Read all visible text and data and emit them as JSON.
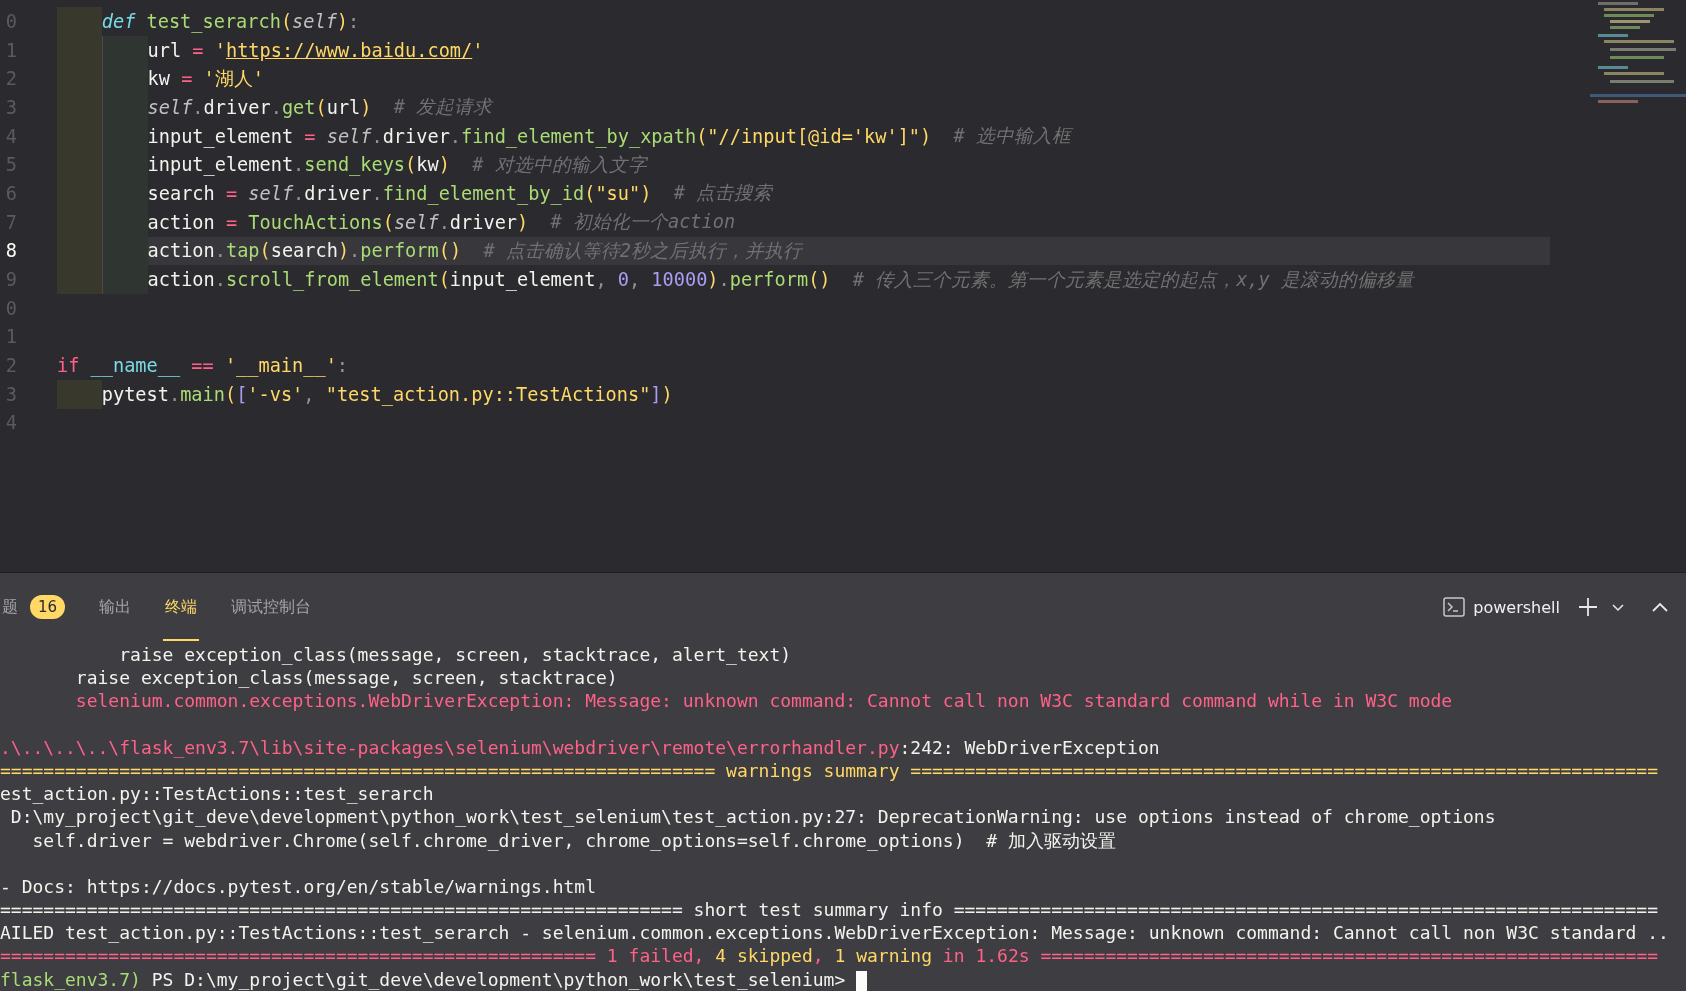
{
  "editor": {
    "lines": [
      {
        "number": "0",
        "current": false,
        "kind": "indent1",
        "tokens": [
          {
            "kind": "kw",
            "text": "def"
          },
          {
            "kind": "fn",
            "text": "test_serarch"
          },
          {
            "kind": "bracket",
            "text": "("
          },
          {
            "kind": "self",
            "text": "self"
          },
          {
            "kind": "bracket",
            "text": ")"
          },
          {
            "kind": "punct",
            "text": ":"
          }
        ]
      },
      {
        "number": "1",
        "current": false,
        "kind": "indent2",
        "tokens": [
          {
            "kind": "plain",
            "text": "url"
          },
          {
            "kind": "op",
            "text": " = "
          },
          {
            "kind": "str",
            "text": "'"
          },
          {
            "kind": "url",
            "text": "https://www.baidu.com/"
          },
          {
            "kind": "str",
            "text": "'"
          }
        ]
      },
      {
        "number": "2",
        "current": false,
        "kind": "indent2",
        "tokens": [
          {
            "kind": "plain",
            "text": "kw"
          },
          {
            "kind": "op",
            "text": " = "
          },
          {
            "kind": "str",
            "text": "'湖人'"
          }
        ]
      },
      {
        "number": "3",
        "current": false,
        "kind": "indent2",
        "tokens": [
          {
            "kind": "self",
            "text": "self"
          },
          {
            "kind": "punct",
            "text": "."
          },
          {
            "kind": "plain",
            "text": "driver"
          },
          {
            "kind": "punct",
            "text": "."
          },
          {
            "kind": "method",
            "text": "get"
          },
          {
            "kind": "bracket",
            "text": "("
          },
          {
            "kind": "plain",
            "text": "url"
          },
          {
            "kind": "bracket",
            "text": ")"
          },
          {
            "kind": "cmt",
            "text": "# 发起请求"
          }
        ]
      },
      {
        "number": "4",
        "current": false,
        "kind": "indent2",
        "tokens": [
          {
            "kind": "plain",
            "text": "input_element"
          },
          {
            "kind": "op",
            "text": " = "
          },
          {
            "kind": "self",
            "text": "self"
          },
          {
            "kind": "punct",
            "text": "."
          },
          {
            "kind": "plain",
            "text": "driver"
          },
          {
            "kind": "punct",
            "text": "."
          },
          {
            "kind": "method",
            "text": "find_element_by_xpath"
          },
          {
            "kind": "bracket",
            "text": "("
          },
          {
            "kind": "str",
            "text": "\"//input[@id='kw']\""
          },
          {
            "kind": "bracket",
            "text": ")"
          },
          {
            "kind": "cmt",
            "text": "# 选中输入框"
          }
        ]
      },
      {
        "number": "5",
        "current": false,
        "kind": "indent2",
        "tokens": [
          {
            "kind": "plain",
            "text": "input_element"
          },
          {
            "kind": "punct",
            "text": "."
          },
          {
            "kind": "method",
            "text": "send_keys"
          },
          {
            "kind": "bracket",
            "text": "("
          },
          {
            "kind": "plain",
            "text": "kw"
          },
          {
            "kind": "bracket",
            "text": ")"
          },
          {
            "kind": "cmt",
            "text": "# 对选中的输入文字"
          }
        ]
      },
      {
        "number": "6",
        "current": false,
        "kind": "indent2",
        "tokens": [
          {
            "kind": "plain",
            "text": "search"
          },
          {
            "kind": "op",
            "text": " = "
          },
          {
            "kind": "self",
            "text": "self"
          },
          {
            "kind": "punct",
            "text": "."
          },
          {
            "kind": "plain",
            "text": "driver"
          },
          {
            "kind": "punct",
            "text": "."
          },
          {
            "kind": "method",
            "text": "find_element_by_id"
          },
          {
            "kind": "bracket",
            "text": "("
          },
          {
            "kind": "str",
            "text": "\"su\""
          },
          {
            "kind": "bracket",
            "text": ")"
          },
          {
            "kind": "cmt",
            "text": "# 点击搜索"
          }
        ]
      },
      {
        "number": "7",
        "current": false,
        "kind": "indent2",
        "tokens": [
          {
            "kind": "plain",
            "text": "action"
          },
          {
            "kind": "op",
            "text": " = "
          },
          {
            "kind": "method",
            "text": "TouchActions"
          },
          {
            "kind": "bracket",
            "text": "("
          },
          {
            "kind": "self",
            "text": "self"
          },
          {
            "kind": "punct",
            "text": "."
          },
          {
            "kind": "plain",
            "text": "driver"
          },
          {
            "kind": "bracket",
            "text": ")"
          },
          {
            "kind": "cmt",
            "text": "# 初始化一个action"
          }
        ]
      },
      {
        "number": "8",
        "current": true,
        "kind": "indent2",
        "tokens": [
          {
            "kind": "plain",
            "text": "action"
          },
          {
            "kind": "punct",
            "text": "."
          },
          {
            "kind": "method",
            "text": "tap"
          },
          {
            "kind": "bracket",
            "text": "("
          },
          {
            "kind": "plain",
            "text": "search"
          },
          {
            "kind": "bracket",
            "text": ")"
          },
          {
            "kind": "punct",
            "text": "."
          },
          {
            "kind": "method",
            "text": "perform"
          },
          {
            "kind": "bracket",
            "text": "()"
          },
          {
            "kind": "cmt",
            "text": "# 点击确认等待2秒之后执行，并执行"
          }
        ]
      },
      {
        "number": "9",
        "current": false,
        "kind": "indent2",
        "tokens": [
          {
            "kind": "plain",
            "text": "action"
          },
          {
            "kind": "punct",
            "text": "."
          },
          {
            "kind": "method",
            "text": "scroll_from_element"
          },
          {
            "kind": "bracket",
            "text": "("
          },
          {
            "kind": "plain",
            "text": "input_element"
          },
          {
            "kind": "punct",
            "text": ", "
          },
          {
            "kind": "num",
            "text": "0"
          },
          {
            "kind": "punct",
            "text": ", "
          },
          {
            "kind": "num",
            "text": "10000"
          },
          {
            "kind": "bracket",
            "text": ")"
          },
          {
            "kind": "punct",
            "text": "."
          },
          {
            "kind": "method",
            "text": "perform"
          },
          {
            "kind": "bracket",
            "text": "()"
          },
          {
            "kind": "cmt",
            "text": "# 传入三个元素。第一个元素是选定的起点，x,y 是滚动的偏移量"
          }
        ]
      },
      {
        "number": "0",
        "current": false,
        "kind": "top"
      },
      {
        "number": "1",
        "current": false,
        "kind": "top"
      },
      {
        "number": "2",
        "current": false,
        "kind": "top",
        "tokens": [
          {
            "kind": "kw2",
            "text": "if"
          },
          {
            "kind": "dunder",
            "text": "__name__"
          },
          {
            "kind": "op",
            "text": " == "
          },
          {
            "kind": "str",
            "text": "'__main__'"
          },
          {
            "kind": "punct",
            "text": ":"
          }
        ]
      },
      {
        "number": "3",
        "current": false,
        "kind": "indent1",
        "tokens": [
          {
            "kind": "plain",
            "text": "pytest"
          },
          {
            "kind": "punct",
            "text": "."
          },
          {
            "kind": "method",
            "text": "main"
          },
          {
            "kind": "bracket",
            "text": "("
          },
          {
            "kind": "bracket2",
            "text": "["
          },
          {
            "kind": "str",
            "text": "'-vs'"
          },
          {
            "kind": "punct",
            "text": ", "
          },
          {
            "kind": "str",
            "text": "\"test_action.py::TestActions\""
          },
          {
            "kind": "bracket2",
            "text": "]"
          },
          {
            "kind": "bracket",
            "text": ")"
          }
        ]
      },
      {
        "number": "4",
        "current": false,
        "kind": "top"
      }
    ]
  },
  "panel": {
    "tabs": [
      {
        "label": "题",
        "selected": false,
        "badge": "16"
      },
      {
        "label": "输出",
        "selected": false
      },
      {
        "label": "终端",
        "selected": true
      },
      {
        "label": "调试控制台",
        "selected": false
      }
    ],
    "shell": "powershell"
  },
  "terminal": {
    "lines": [
      {
        "segments": [
          {
            "kind": "text",
            "text": "           raise exception_class(message, screen, stacktrace, alert_text)"
          }
        ]
      },
      {
        "segments": [
          {
            "kind": "text",
            "text": "       raise exception_class(message, screen, stacktrace)"
          }
        ]
      },
      {
        "segments": [
          {
            "kind": "error",
            "text": "       selenium.common.exceptions.WebDriverException: Message: unknown command: Cannot call non W3C standard command while in W3C mode"
          }
        ]
      },
      {
        "gap_above": true,
        "segments": [
          {
            "kind": "error",
            "text": ".\\..\\..\\..\\flask_env3.7\\lib\\site-packages\\selenium\\webdriver\\remote\\errorhandler.py"
          },
          {
            "kind": "text",
            "text": ":242: WebDriverException"
          }
        ]
      },
      {
        "segments": [
          {
            "kind": "warn",
            "text": "================================================================== warnings summary ====================================================================="
          }
        ]
      },
      {
        "segments": [
          {
            "kind": "text",
            "text": "est_action.py::TestActions::test_serarch"
          }
        ]
      },
      {
        "segments": [
          {
            "kind": "text",
            "text": " D:\\my_project\\git_deve\\development\\python_work\\test_selenium\\test_action.py:27: DeprecationWarning: use options instead of chrome_options"
          }
        ]
      },
      {
        "segments": [
          {
            "kind": "text",
            "text": "   self.driver = webdriver.Chrome(self.chrome_driver, chrome_options=self.chrome_options)  # 加入驱动设置"
          }
        ]
      },
      {
        "gap_above": true,
        "segments": [
          {
            "kind": "text",
            "text": "- Docs: https://docs.pytest.org/en/stable/warnings.html"
          }
        ]
      },
      {
        "segments": [
          {
            "kind": "text",
            "text": "=============================================================== short test summary info ================================================================="
          }
        ]
      },
      {
        "segments": [
          {
            "kind": "text",
            "text": "AILED test_action.py::TestActions::test_serarch - selenium.common.exceptions.WebDriverException: Message: unknown command: Cannot call non W3C standard .."
          }
        ]
      },
      {
        "segments": [
          {
            "kind": "error",
            "text": "======================================================= 1 failed"
          },
          {
            "kind": "error",
            "text": ", "
          },
          {
            "kind": "warn",
            "text": "4 skipped"
          },
          {
            "kind": "error",
            "text": ", "
          },
          {
            "kind": "warn",
            "text": "1 warning"
          },
          {
            "kind": "error",
            "text": " in 1.62s ========================================================="
          }
        ]
      },
      {
        "segments": [
          {
            "kind": "ok",
            "text": "flask_env3.7)"
          },
          {
            "kind": "text",
            "text": " PS D:\\my_project\\git_deve\\development\\python_work\\test_selenium> "
          }
        ],
        "cursor": true
      }
    ]
  }
}
